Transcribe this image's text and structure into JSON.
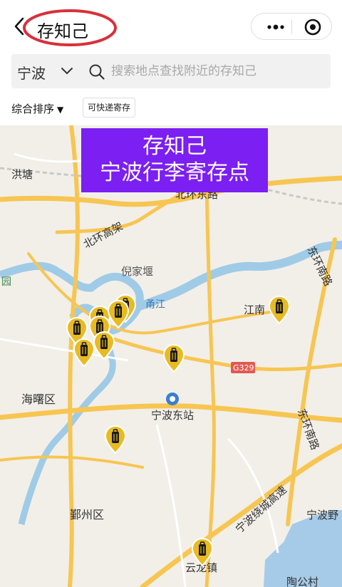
{
  "header": {
    "back_icon": "chevron-left-icon",
    "title": "存知己",
    "menu_icon": "more-dots-icon",
    "close_icon": "target-close-icon",
    "highlight_color": "#d9303a"
  },
  "search": {
    "city": "宁波",
    "placeholder": "搜索地点查找附近的存知己"
  },
  "filters": {
    "sort_label": "综合排序",
    "sort_arrow": "▼",
    "chip_label": "可快递寄存"
  },
  "map": {
    "banner_line1": "存知己",
    "banner_line2": "宁波行李寄存点",
    "banner_color": "#7b1ff2",
    "marker_color": "#e8bb23",
    "marker_icon": "luggage-icon",
    "labels": {
      "hongtang": "洪塘",
      "beihuandong": "北环东路",
      "beihuangaojia": "北环高架",
      "nijiayan": "倪家堰",
      "yongjiang": "甬江",
      "jiangnan": "江南",
      "donghuannan": "东环南路",
      "g329": "G329",
      "haishu": "海曙区",
      "ningbodongzhan": "宁波东站",
      "donghuannanlu": "东环南路",
      "raochengexpress": "宁波绕城高速",
      "ningboye": "宁波野",
      "yinzhou": "鄞州区",
      "yunlong": "云龙镇",
      "taogongcun": "陶公村",
      "yuan": "园",
      "huanlu_label": "东环南路"
    }
  }
}
